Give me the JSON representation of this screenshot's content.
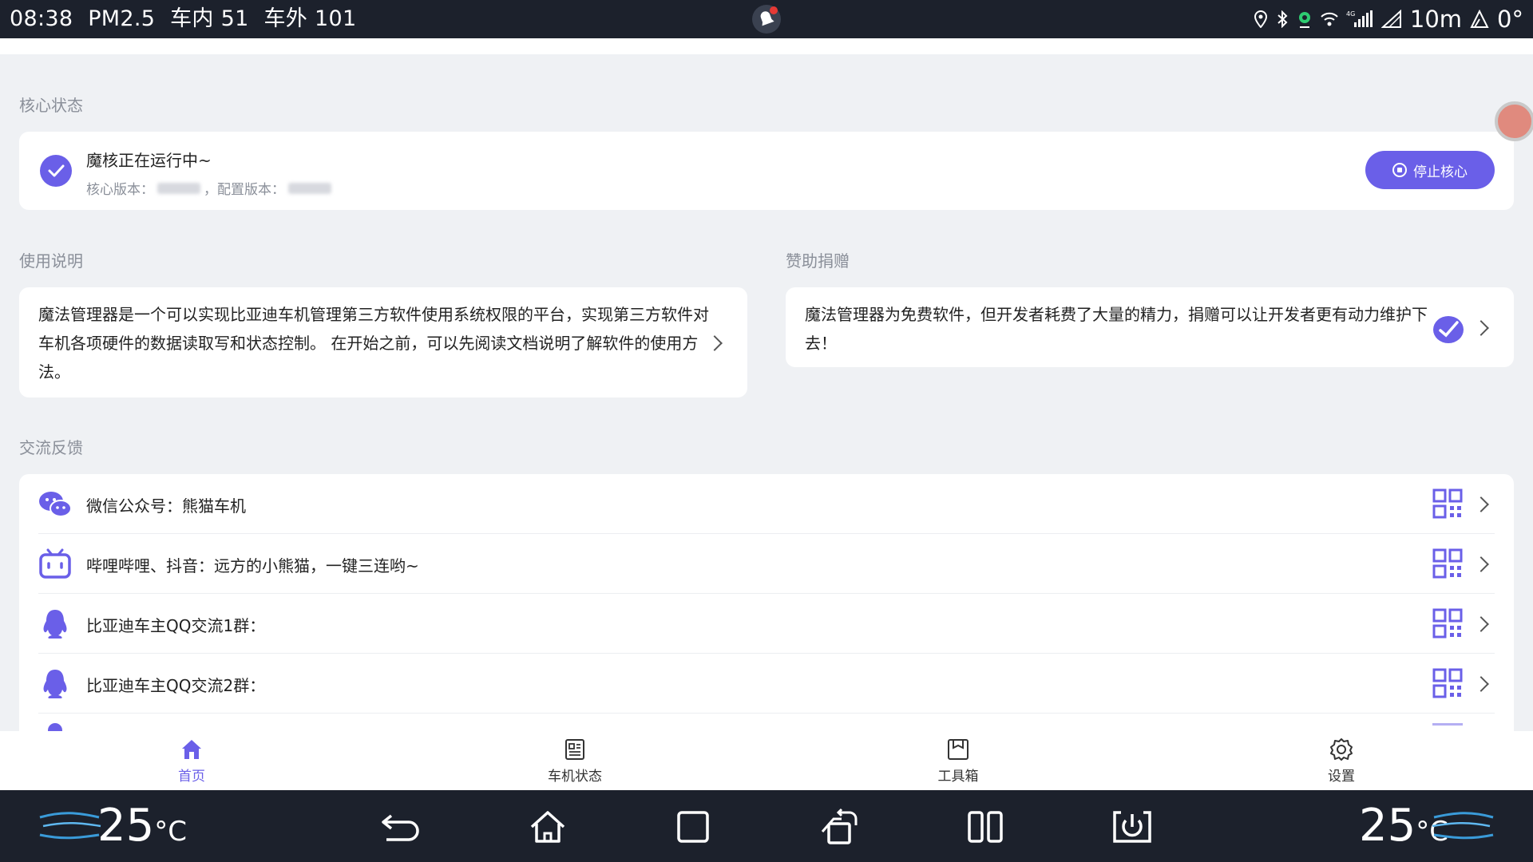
{
  "status_bar": {
    "time": "08:38",
    "pm25_label": "PM2.5",
    "inside_label": "车内",
    "inside_value": "51",
    "outside_label": "车外",
    "outside_value": "101",
    "altitude": "10m",
    "angle": "0°",
    "network": "4G"
  },
  "core_status": {
    "section_title": "核心状态",
    "title": "魔核正在运行中~",
    "core_version_label": "核心版本：",
    "config_version_label": "，配置版本：",
    "stop_button_label": "停止核心"
  },
  "usage": {
    "section_title": "使用说明",
    "text": "魔法管理器是一个可以实现比亚迪车机管理第三方软件使用系统权限的平台，实现第三方软件对车机各项硬件的数据读取写和状态控制。 在开始之前，可以先阅读文档说明了解软件的使用方法。"
  },
  "donate": {
    "section_title": "赞助捐赠",
    "text": "魔法管理器为免费软件，但开发者耗费了大量的精力，捐赠可以让开发者更有动力维护下去！"
  },
  "feedback": {
    "section_title": "交流反馈",
    "items": [
      {
        "label": "微信公众号：熊猫车机",
        "icon": "wechat-icon"
      },
      {
        "label": "哔哩哔哩、抖音：远方的小熊猫，一键三连哟~",
        "icon": "bilibili-icon"
      },
      {
        "label": "比亚迪车主QQ交流1群：",
        "icon": "qq-icon"
      },
      {
        "label": "比亚迪车主QQ交流2群：",
        "icon": "qq-icon"
      }
    ]
  },
  "bottom_nav": [
    {
      "label": "首页",
      "icon": "home-icon",
      "active": true
    },
    {
      "label": "车机状态",
      "icon": "status-icon",
      "active": false
    },
    {
      "label": "工具箱",
      "icon": "toolbox-icon",
      "active": false
    },
    {
      "label": "设置",
      "icon": "settings-icon",
      "active": false
    }
  ],
  "system_bar": {
    "left_temp": "25",
    "right_temp": "25",
    "temp_unit": "°C"
  },
  "colors": {
    "accent": "#6a5fe8",
    "bar_bg": "#1c212c",
    "page_bg": "#eff1f4"
  }
}
